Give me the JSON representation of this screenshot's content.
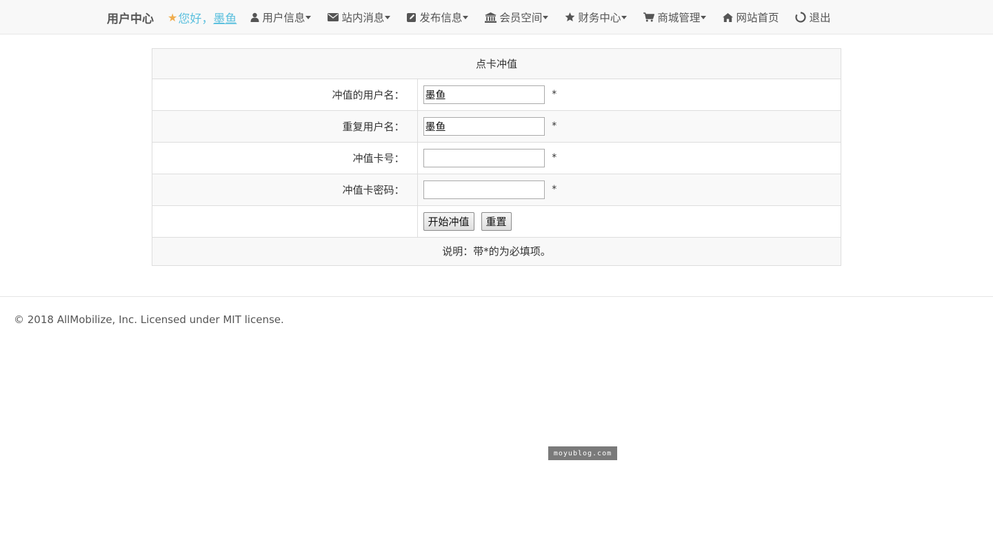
{
  "nav": {
    "brand": "用户中心",
    "greeting_prefix": "您好，",
    "username": "墨鱼",
    "items": [
      {
        "label": "用户信息",
        "icon": "user-icon",
        "dropdown": true
      },
      {
        "label": "站内消息",
        "icon": "envelope-icon",
        "dropdown": true
      },
      {
        "label": "发布信息",
        "icon": "edit-icon",
        "dropdown": true
      },
      {
        "label": "会员空间",
        "icon": "bank-icon",
        "dropdown": true
      },
      {
        "label": "财务中心",
        "icon": "star-icon",
        "dropdown": true
      },
      {
        "label": "商城管理",
        "icon": "cart-icon",
        "dropdown": true
      },
      {
        "label": "网站首页",
        "icon": "home-icon",
        "dropdown": false
      },
      {
        "label": "退出",
        "icon": "logout-icon",
        "dropdown": false
      }
    ]
  },
  "form": {
    "title": "点卡冲值",
    "rows": [
      {
        "label": "冲值的用户名：",
        "value": "墨鱼",
        "required_mark": "*"
      },
      {
        "label": "重复用户名：",
        "value": "墨鱼",
        "required_mark": "*"
      },
      {
        "label": "冲值卡号：",
        "value": "",
        "required_mark": "*"
      },
      {
        "label": "冲值卡密码：",
        "value": "",
        "required_mark": "*"
      }
    ],
    "submit_label": "开始冲值",
    "reset_label": "重置",
    "note": "说明：带*的为必填项。"
  },
  "footer": {
    "text": "© 2018 AllMobilize, Inc. Licensed under MIT license."
  },
  "watermark": "moyublog.com",
  "colors": {
    "link": "#5bc0de",
    "star": "#f0ad4e",
    "navbar_bg": "#f8f8f8"
  }
}
